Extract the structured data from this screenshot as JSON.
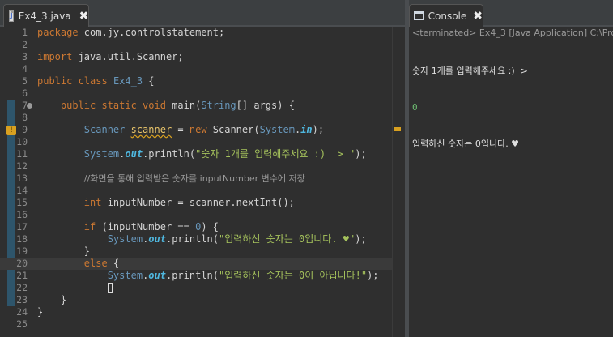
{
  "editor": {
    "tab_title": "Ex4_3.java",
    "file_icon": "java-file-icon",
    "close_glyph": "✖",
    "lines": [
      {
        "n": "1",
        "parts": [
          [
            "kw",
            "package"
          ],
          [
            "t",
            " com.jy.controlstatement;"
          ]
        ]
      },
      {
        "n": "2",
        "parts": []
      },
      {
        "n": "3",
        "parts": [
          [
            "kw",
            "import"
          ],
          [
            "t",
            " java.util.Scanner;"
          ]
        ]
      },
      {
        "n": "4",
        "parts": []
      },
      {
        "n": "5",
        "parts": [
          [
            "kw",
            "public class"
          ],
          [
            "t",
            " "
          ],
          [
            "cls",
            "Ex4_3"
          ],
          [
            "t",
            " {"
          ]
        ]
      },
      {
        "n": "6",
        "parts": []
      },
      {
        "n": "7",
        "fold": true,
        "parts": [
          [
            "t",
            "    "
          ],
          [
            "kw",
            "public static void"
          ],
          [
            "t",
            " main("
          ],
          [
            "cls",
            "String"
          ],
          [
            "t",
            "[] args) {"
          ]
        ]
      },
      {
        "n": "8",
        "parts": []
      },
      {
        "n": "9",
        "parts": [
          [
            "t",
            "        "
          ],
          [
            "cls",
            "Scanner"
          ],
          [
            "t",
            " "
          ],
          [
            "var",
            "scanner"
          ],
          [
            "t",
            " = "
          ],
          [
            "kw",
            "new"
          ],
          [
            "t",
            " Scanner("
          ],
          [
            "cls",
            "System"
          ],
          [
            "t",
            "."
          ],
          [
            "fld",
            "in"
          ],
          [
            "t",
            ");"
          ]
        ]
      },
      {
        "n": "10",
        "parts": []
      },
      {
        "n": "11",
        "parts": [
          [
            "t",
            "        "
          ],
          [
            "cls",
            "System"
          ],
          [
            "t",
            "."
          ],
          [
            "fld",
            "out"
          ],
          [
            "t",
            ".println("
          ],
          [
            "str",
            "\"숫자 1개를 입력해주세요 :)  > \""
          ],
          [
            "t",
            ");"
          ]
        ]
      },
      {
        "n": "12",
        "parts": []
      },
      {
        "n": "13",
        "parts": [
          [
            "t",
            "        "
          ],
          [
            "cmt",
            "//화면을 통해 입력받은 숫자를 inputNumber 변수에 저장"
          ]
        ]
      },
      {
        "n": "14",
        "parts": []
      },
      {
        "n": "15",
        "parts": [
          [
            "t",
            "        "
          ],
          [
            "kw",
            "int"
          ],
          [
            "t",
            " inputNumber = scanner.nextInt();"
          ]
        ]
      },
      {
        "n": "16",
        "parts": []
      },
      {
        "n": "17",
        "parts": [
          [
            "t",
            "        "
          ],
          [
            "kw",
            "if"
          ],
          [
            "t",
            " (inputNumber == "
          ],
          [
            "num",
            "0"
          ],
          [
            "t",
            ") {"
          ]
        ]
      },
      {
        "n": "18",
        "parts": [
          [
            "t",
            "            "
          ],
          [
            "cls",
            "System"
          ],
          [
            "t",
            "."
          ],
          [
            "fld",
            "out"
          ],
          [
            "t",
            ".println("
          ],
          [
            "str",
            "\"입력하신 숫자는 0입니다. ♥\""
          ],
          [
            "t",
            ");"
          ]
        ]
      },
      {
        "n": "19",
        "parts": [
          [
            "t",
            "        }"
          ]
        ]
      },
      {
        "n": "20",
        "current": true,
        "parts": [
          [
            "t",
            "        "
          ],
          [
            "kw",
            "else"
          ],
          [
            "t",
            " {"
          ]
        ]
      },
      {
        "n": "21",
        "parts": [
          [
            "t",
            "            "
          ],
          [
            "cls",
            "System"
          ],
          [
            "t",
            "."
          ],
          [
            "fld",
            "out"
          ],
          [
            "t",
            ".println("
          ],
          [
            "str",
            "\"입력하신 숫자는 0이 아닙니다!\""
          ],
          [
            "t",
            ");"
          ]
        ]
      },
      {
        "n": "22",
        "caret": true,
        "parts": [
          [
            "t",
            "            "
          ]
        ]
      },
      {
        "n": "23",
        "parts": [
          [
            "t",
            "    }"
          ]
        ]
      },
      {
        "n": "24",
        "parts": [
          [
            "t",
            "}"
          ]
        ]
      },
      {
        "n": "25",
        "parts": []
      }
    ]
  },
  "console": {
    "tab_title": "Console",
    "tab_icon": "console-icon",
    "close_glyph": "✖",
    "status": "<terminated> Ex4_3 [Java Application] C:\\Pro",
    "output": [
      "숫자 1개를 입력해주세요 :)  >",
      "0",
      "입력하신 숫자는 0입니다. ♥"
    ]
  },
  "colors": {
    "keyword": "#cc7832",
    "class": "#6897bb",
    "string": "#a5c25c",
    "input_echo": "#6fbf73",
    "warning": "#d8a020"
  }
}
